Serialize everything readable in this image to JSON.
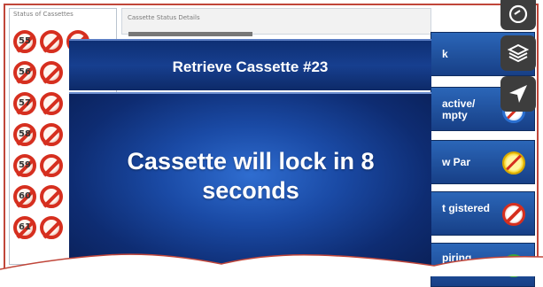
{
  "status_panel": {
    "title": "Status of Cassettes",
    "rows": [
      {
        "number": "55"
      },
      {
        "number": "56"
      },
      {
        "number": "57"
      },
      {
        "number": "58"
      },
      {
        "number": "59"
      },
      {
        "number": "60"
      },
      {
        "number": "61"
      }
    ]
  },
  "details_window": {
    "title": "Cassette Status Details"
  },
  "right_buttons": [
    {
      "label": "k",
      "icon": "no-entry-red-icon"
    },
    {
      "label": "active/ mpty",
      "icon": "no-entry-blue-icon"
    },
    {
      "label": "w Par",
      "icon": "no-entry-yellow-icon"
    },
    {
      "label": "t gistered",
      "icon": "no-entry-red-icon"
    },
    {
      "label": "piring",
      "icon": "check-green-icon"
    }
  ],
  "modal": {
    "title": "Retrieve Cassette #23",
    "message": "Cassette will lock in 8 seconds"
  },
  "colors": {
    "accent_blue": "#173f8f",
    "alert_red": "#d62f1f",
    "frame_red": "#c0463a"
  }
}
